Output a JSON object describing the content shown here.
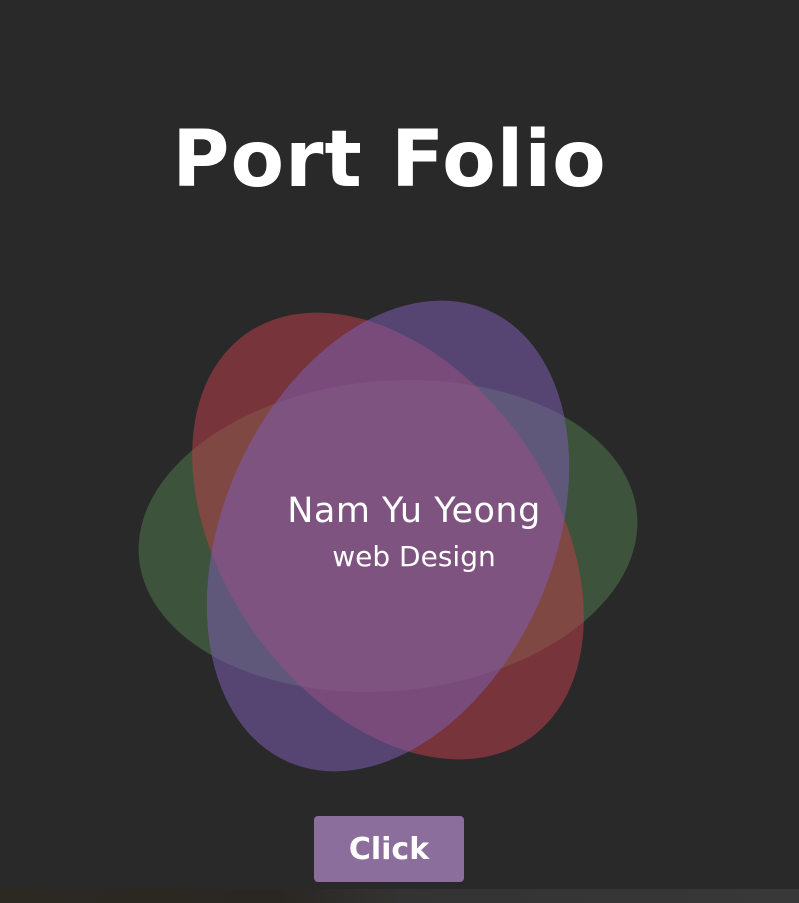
{
  "page": {
    "title": "Port Folio",
    "name": "Nam Yu Yeong",
    "subtitle": "web Design",
    "button_label": "Click"
  },
  "colors": {
    "background": "#292929",
    "green_petal": "#4b7048",
    "red_petal": "#b8404a",
    "purple_petal": "#7b5cb0",
    "button": "#8c6e9d",
    "text": "#ffffff"
  }
}
